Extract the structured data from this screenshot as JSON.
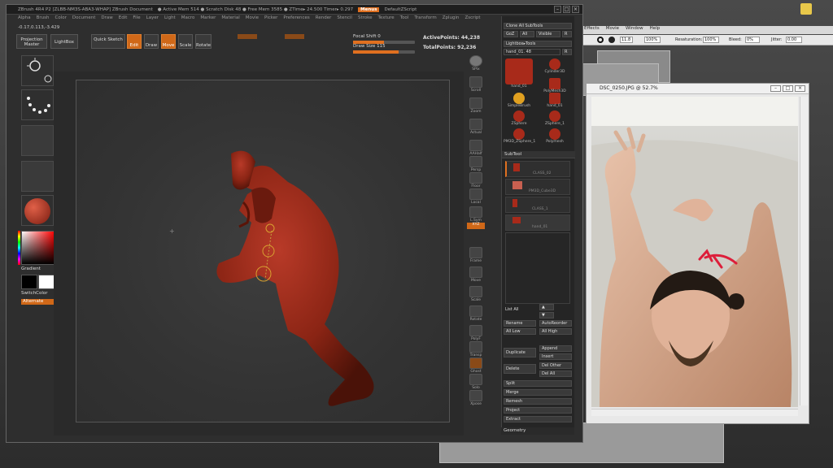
{
  "zbrush": {
    "title": "ZBrush 4R4 P2  [ZLBB-NM3S-ABA3-WHAP]   ZBrush Document",
    "memory": "● Active Mem 514  ● Scratch Disk 48  ● Free Mem 3585  ● ZTime▸ 24.500  Timer▸ 0.297",
    "menus_button": "Menus",
    "script_label": "DefaultZScript",
    "menu_items": [
      "Alpha",
      "Brush",
      "Color",
      "Document",
      "Draw",
      "Edit",
      "File",
      "Layer",
      "Light",
      "Macro",
      "Marker",
      "Material",
      "Movie",
      "Picker",
      "Preferences",
      "Render",
      "Stencil",
      "Stroke",
      "Texture",
      "Tool",
      "Transform",
      "Zplugin",
      "Zscript"
    ],
    "coords": "-0.17,0.113,-3.429",
    "toolbar": {
      "projection_master": "Projection Master",
      "lightbox": "LightBox",
      "quick_sketch": "Quick Sketch",
      "edit": "Edit",
      "draw": "Draw",
      "move": "Move",
      "scale": "Scale",
      "rotate": "Rotate",
      "focal_shift": "Focal Shift 0",
      "draw_size": "Draw Size 115",
      "active_points": "ActivePoints: 44,238",
      "total_points": "TotalPoints: 92,236"
    },
    "left_shelf": {
      "gradient": "Gradient",
      "switch_color": "SwitchColor",
      "alternate": "Alternate"
    },
    "right_shelf": [
      "SPix",
      "Scroll",
      "Zoom",
      "Actual",
      "AAHalf",
      "Persp",
      "Floor",
      "Local",
      "L.Sym",
      "Frame",
      "Move",
      "Scale",
      "Rotate",
      "PolyF",
      "Transp",
      "Ghost",
      "Solo",
      "Xpose"
    ],
    "xyz_label": "XYZ",
    "panel": {
      "clone_all_subtools": "Clone All SubTools",
      "goz": "GoZ",
      "all": "All",
      "visible": "Visible",
      "r": "R",
      "lightbox_tools": "Lightbox▸Tools",
      "current_tool": "hand_01. 48",
      "tools": [
        {
          "name": "hand_01"
        },
        {
          "name": "Cylinder3D"
        },
        {
          "name": "PolyMesh3D"
        },
        {
          "name": "SimpleBrush"
        },
        {
          "name": "hand_01"
        },
        {
          "name": "ZSphere"
        },
        {
          "name": "ZSphere_1"
        },
        {
          "name": "PM3D_ZSphere_1"
        },
        {
          "name": "Polymesh"
        }
      ],
      "subtool_header": "SubTool",
      "subtools": [
        "CLASS_02",
        "PM3D_Cube3D",
        "CLASS_1",
        "hand_01"
      ],
      "list_all": "List All",
      "rename": "Rename",
      "autoreorder": "AutoReorder",
      "all_low": "All Low",
      "all_high": "All High",
      "duplicate": "Duplicate",
      "append": "Append",
      "insert": "Insert",
      "delete": "Delete",
      "del_other": "Del Other",
      "del_all": "Del All",
      "split": "Split",
      "merge": "Merge",
      "remesh": "Remesh",
      "project": "Project",
      "extract": "Extract",
      "geometry": "Geometry"
    }
  },
  "photoshop": {
    "menu": [
      "Effects",
      "Movie",
      "Window",
      "Help"
    ],
    "brush_size": "11.8",
    "zoom": "100%",
    "resaturation_label": "Resaturation:",
    "resaturation": "100%",
    "bleed_label": "Bleed:",
    "bleed": "0%",
    "jitter_label": "Jitter:",
    "jitter": "0.00",
    "photo_title": "DSC_0250.JPG @ 52.7%"
  },
  "colors": {
    "accent": "#e07020",
    "clay": "#a82a1a"
  }
}
